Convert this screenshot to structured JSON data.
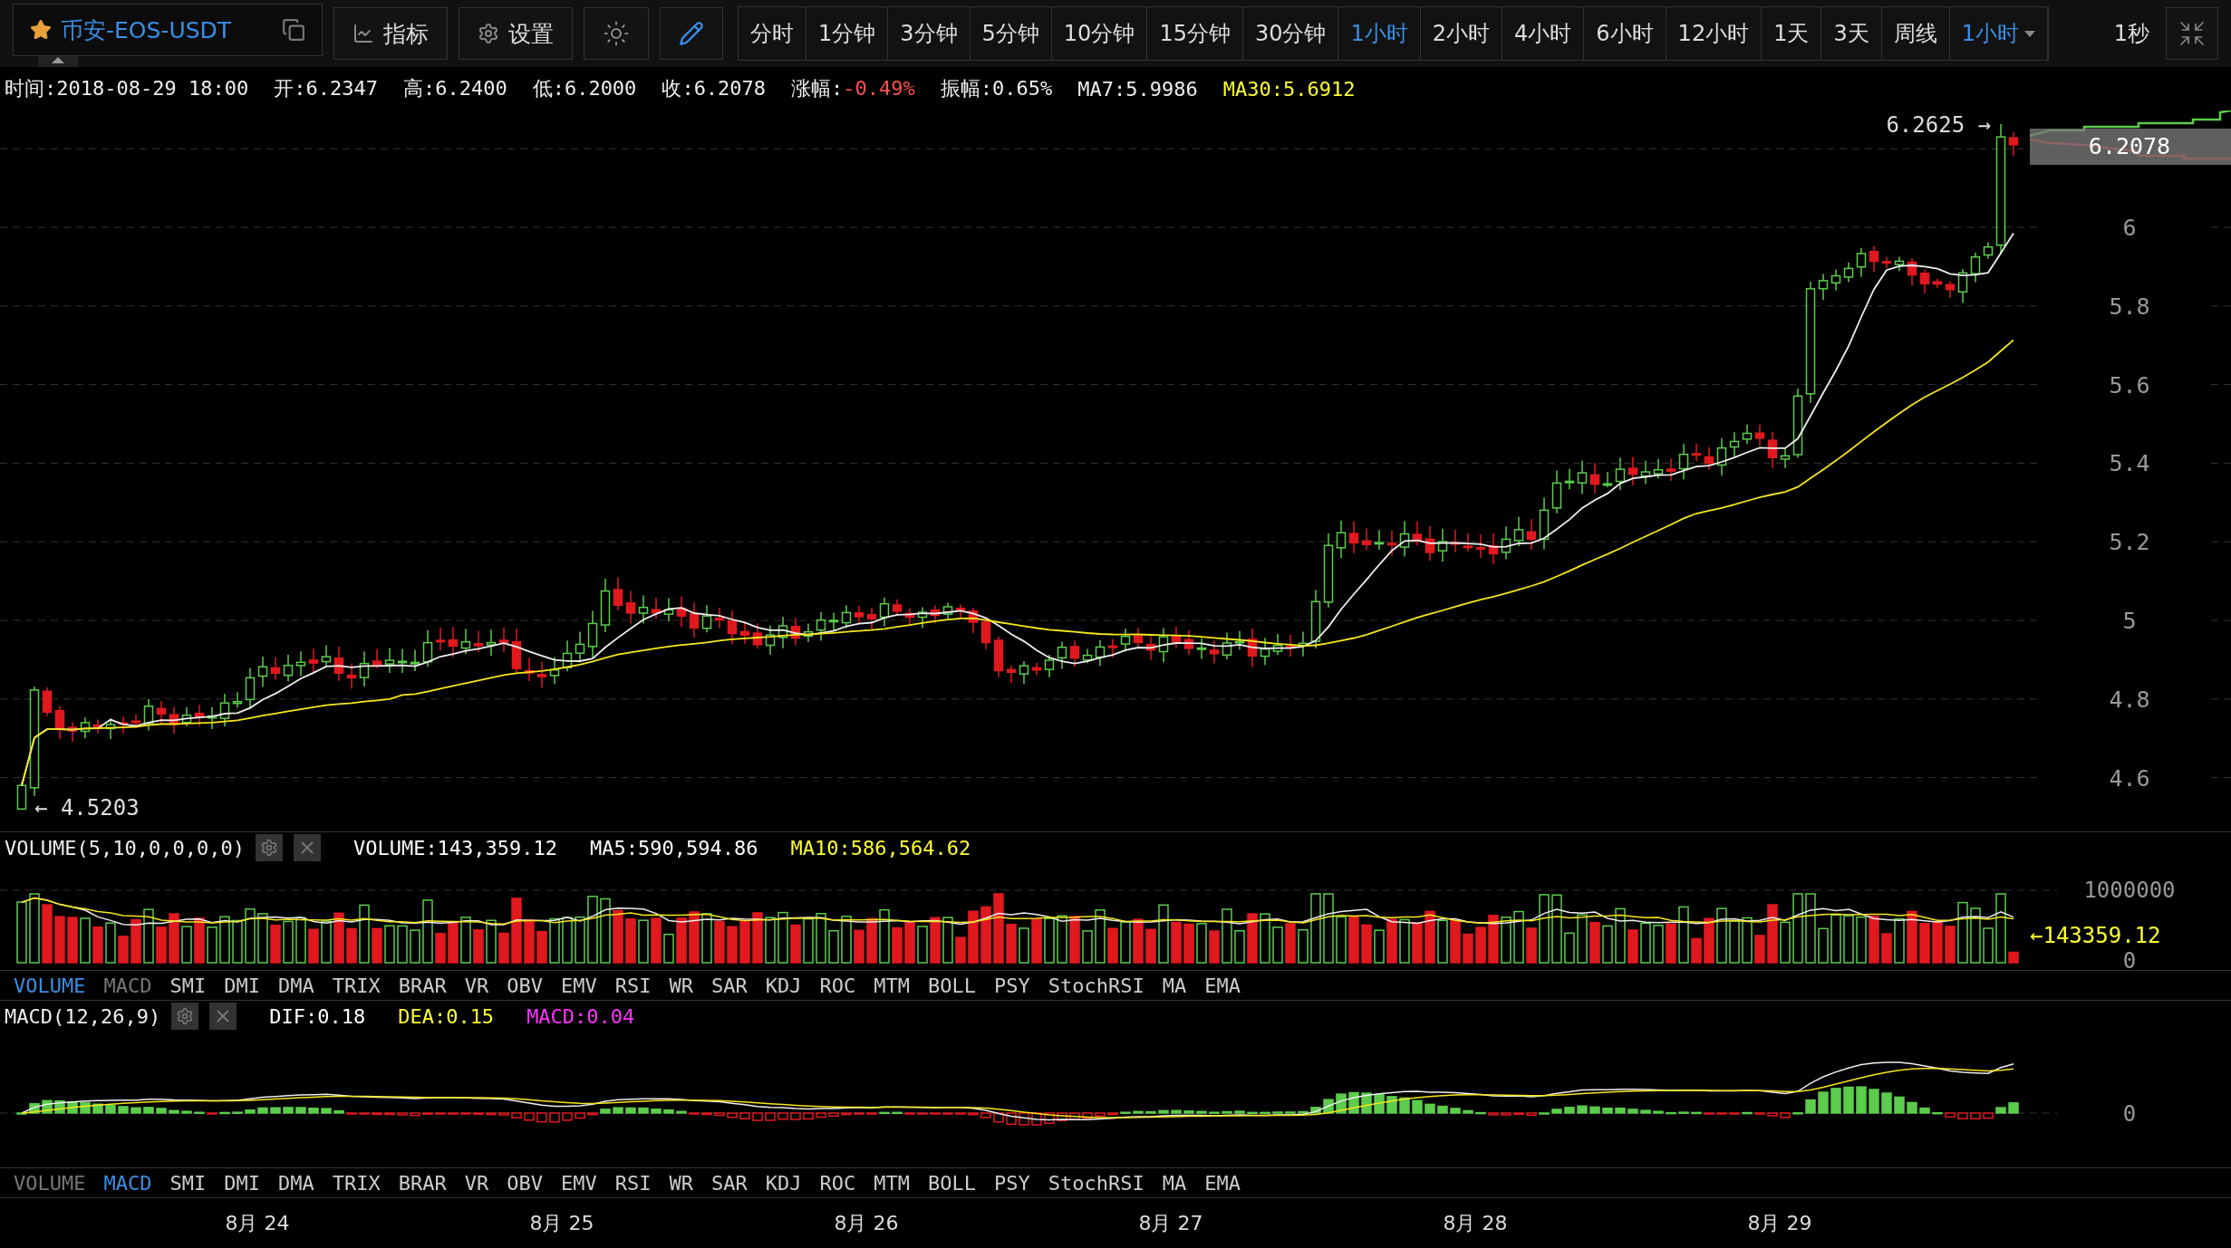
{
  "toolbar": {
    "symbol": "币安-EOS-USDT",
    "indicator_button": "指标",
    "settings_button": "设置",
    "intervals": [
      {
        "label": "分时",
        "selected": false
      },
      {
        "label": "1分钟",
        "selected": false
      },
      {
        "label": "3分钟",
        "selected": false
      },
      {
        "label": "5分钟",
        "selected": false
      },
      {
        "label": "10分钟",
        "selected": false
      },
      {
        "label": "15分钟",
        "selected": false
      },
      {
        "label": "30分钟",
        "selected": false
      },
      {
        "label": "1小时",
        "selected": true
      },
      {
        "label": "2小时",
        "selected": false
      },
      {
        "label": "4小时",
        "selected": false
      },
      {
        "label": "6小时",
        "selected": false
      },
      {
        "label": "12小时",
        "selected": false
      },
      {
        "label": "1天",
        "selected": false
      },
      {
        "label": "3天",
        "selected": false
      },
      {
        "label": "周线",
        "selected": false
      }
    ],
    "interval_dropdown": "1小时",
    "refresh": "1秒"
  },
  "info": [
    {
      "kind": "plain",
      "label": "时间:",
      "value": "2018-08-29 18:00"
    },
    {
      "kind": "plain",
      "label": "开:",
      "value": "6.2347"
    },
    {
      "kind": "plain",
      "label": "高:",
      "value": "6.2400"
    },
    {
      "kind": "plain",
      "label": "低:",
      "value": "6.2000"
    },
    {
      "kind": "plain",
      "label": "收:",
      "value": "6.2078"
    },
    {
      "kind": "change",
      "label": "涨幅:",
      "value": "-0.49%"
    },
    {
      "kind": "plain",
      "label": "振幅:",
      "value": "0.65%"
    },
    {
      "kind": "plain",
      "label": "MA7:",
      "value": "5.9986"
    },
    {
      "kind": "ma30",
      "label": "MA30:",
      "value": "5.6912"
    }
  ],
  "price_chart": {
    "axis": [
      "6",
      "5.8",
      "5.6",
      "5.4",
      "5.2",
      "5",
      "4.8",
      "4.6"
    ],
    "high_marker": "6.2625 →",
    "low_marker": "← 4.5203",
    "last_price": "6.2078"
  },
  "volume_panel": {
    "header": "VOLUME(5,10,0,0,0,0)",
    "values": [
      {
        "text": "VOLUME:143,359.12",
        "color": "#ffffff"
      },
      {
        "text": "MA5:590,594.86",
        "color": "#ffffff"
      },
      {
        "text": "MA10:586,564.62",
        "color": "#ffff33"
      }
    ],
    "axis": [
      "1000000",
      "0"
    ],
    "last_volume": "←143359.12",
    "tabs": [
      {
        "label": "VOLUME",
        "selected": true,
        "dimmed": false
      },
      {
        "label": "MACD",
        "selected": false,
        "dimmed": true
      },
      {
        "label": "SMI",
        "selected": false,
        "dimmed": false
      },
      {
        "label": "DMI",
        "selected": false,
        "dimmed": false
      },
      {
        "label": "DMA",
        "selected": false,
        "dimmed": false
      },
      {
        "label": "TRIX",
        "selected": false,
        "dimmed": false
      },
      {
        "label": "BRAR",
        "selected": false,
        "dimmed": false
      },
      {
        "label": "VR",
        "selected": false,
        "dimmed": false
      },
      {
        "label": "OBV",
        "selected": false,
        "dimmed": false
      },
      {
        "label": "EMV",
        "selected": false,
        "dimmed": false
      },
      {
        "label": "RSI",
        "selected": false,
        "dimmed": false
      },
      {
        "label": "WR",
        "selected": false,
        "dimmed": false
      },
      {
        "label": "SAR",
        "selected": false,
        "dimmed": false
      },
      {
        "label": "KDJ",
        "selected": false,
        "dimmed": false
      },
      {
        "label": "ROC",
        "selected": false,
        "dimmed": false
      },
      {
        "label": "MTM",
        "selected": false,
        "dimmed": false
      },
      {
        "label": "BOLL",
        "selected": false,
        "dimmed": false
      },
      {
        "label": "PSY",
        "selected": false,
        "dimmed": false
      },
      {
        "label": "StochRSI",
        "selected": false,
        "dimmed": false
      },
      {
        "label": "MA",
        "selected": false,
        "dimmed": false
      },
      {
        "label": "EMA",
        "selected": false,
        "dimmed": false
      }
    ]
  },
  "macd_panel": {
    "header": "MACD(12,26,9)",
    "values": [
      {
        "text": "DIF:0.18",
        "color": "#ffffff"
      },
      {
        "text": "DEA:0.15",
        "color": "#ffff33"
      },
      {
        "text": "MACD:0.04",
        "color": "#ff33ff"
      }
    ],
    "axis": [
      "0"
    ],
    "tabs": [
      {
        "label": "VOLUME",
        "selected": false,
        "dimmed": true
      },
      {
        "label": "MACD",
        "selected": true,
        "dimmed": false
      },
      {
        "label": "SMI",
        "selected": false,
        "dimmed": false
      },
      {
        "label": "DMI",
        "selected": false,
        "dimmed": false
      },
      {
        "label": "DMA",
        "selected": false,
        "dimmed": false
      },
      {
        "label": "TRIX",
        "selected": false,
        "dimmed": false
      },
      {
        "label": "BRAR",
        "selected": false,
        "dimmed": false
      },
      {
        "label": "VR",
        "selected": false,
        "dimmed": false
      },
      {
        "label": "OBV",
        "selected": false,
        "dimmed": false
      },
      {
        "label": "EMV",
        "selected": false,
        "dimmed": false
      },
      {
        "label": "RSI",
        "selected": false,
        "dimmed": false
      },
      {
        "label": "WR",
        "selected": false,
        "dimmed": false
      },
      {
        "label": "SAR",
        "selected": false,
        "dimmed": false
      },
      {
        "label": "KDJ",
        "selected": false,
        "dimmed": false
      },
      {
        "label": "ROC",
        "selected": false,
        "dimmed": false
      },
      {
        "label": "MTM",
        "selected": false,
        "dimmed": false
      },
      {
        "label": "BOLL",
        "selected": false,
        "dimmed": false
      },
      {
        "label": "PSY",
        "selected": false,
        "dimmed": false
      },
      {
        "label": "StochRSI",
        "selected": false,
        "dimmed": false
      },
      {
        "label": "MA",
        "selected": false,
        "dimmed": false
      },
      {
        "label": "EMA",
        "selected": false,
        "dimmed": false
      }
    ]
  },
  "dates": [
    "8月 24",
    "8月 25",
    "8月 26",
    "8月 27",
    "8月 28",
    "8月 29"
  ]
}
